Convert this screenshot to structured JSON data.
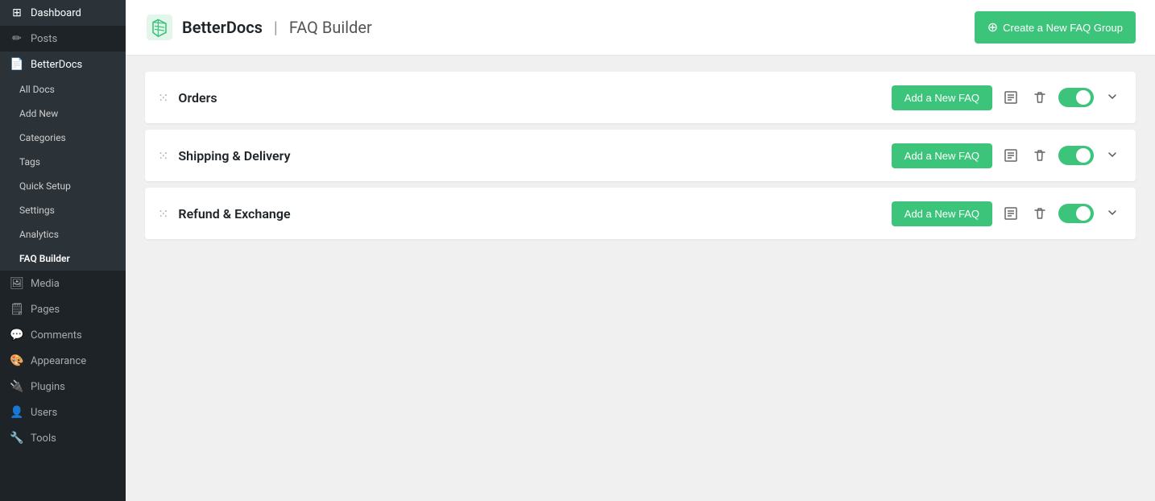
{
  "sidebar": {
    "items": [
      {
        "id": "dashboard",
        "label": "Dashboard",
        "icon": "⊞",
        "active": false
      },
      {
        "id": "posts",
        "label": "Posts",
        "icon": "📝",
        "active": false
      },
      {
        "id": "betterdocs",
        "label": "BetterDocs",
        "icon": "📄",
        "active": true
      },
      {
        "id": "media",
        "label": "Media",
        "icon": "🖼",
        "active": false
      },
      {
        "id": "pages",
        "label": "Pages",
        "icon": "🗒",
        "active": false
      },
      {
        "id": "comments",
        "label": "Comments",
        "icon": "💬",
        "active": false
      },
      {
        "id": "appearance",
        "label": "Appearance",
        "icon": "🎨",
        "active": false
      },
      {
        "id": "plugins",
        "label": "Plugins",
        "icon": "🔌",
        "active": false
      },
      {
        "id": "users",
        "label": "Users",
        "icon": "👤",
        "active": false
      },
      {
        "id": "tools",
        "label": "Tools",
        "icon": "🔧",
        "active": false
      }
    ],
    "submenu": [
      {
        "id": "all-docs",
        "label": "All Docs",
        "active": false
      },
      {
        "id": "add-new",
        "label": "Add New",
        "active": false
      },
      {
        "id": "categories",
        "label": "Categories",
        "active": false
      },
      {
        "id": "tags",
        "label": "Tags",
        "active": false
      },
      {
        "id": "quick-setup",
        "label": "Quick Setup",
        "active": false
      },
      {
        "id": "settings",
        "label": "Settings",
        "active": false
      },
      {
        "id": "analytics",
        "label": "Analytics",
        "active": false
      },
      {
        "id": "faq-builder",
        "label": "FAQ Builder",
        "active": true
      }
    ]
  },
  "header": {
    "logo_alt": "BetterDocs logo",
    "title": "BetterDocs",
    "separator": "|",
    "subtitle": "FAQ Builder",
    "create_btn_label": "Create a New FAQ Group",
    "create_btn_icon": "+"
  },
  "faq_groups": [
    {
      "id": "orders",
      "name": "Orders",
      "add_btn_label": "Add a New FAQ",
      "enabled": true
    },
    {
      "id": "shipping",
      "name": "Shipping & Delivery",
      "add_btn_label": "Add a New FAQ",
      "enabled": true
    },
    {
      "id": "refund",
      "name": "Refund & Exchange",
      "add_btn_label": "Add a New FAQ",
      "enabled": true
    }
  ],
  "colors": {
    "green": "#3bc47a",
    "sidebar_bg": "#1d2327",
    "sidebar_active": "#2271b1",
    "sidebar_hover": "#2c3338"
  }
}
